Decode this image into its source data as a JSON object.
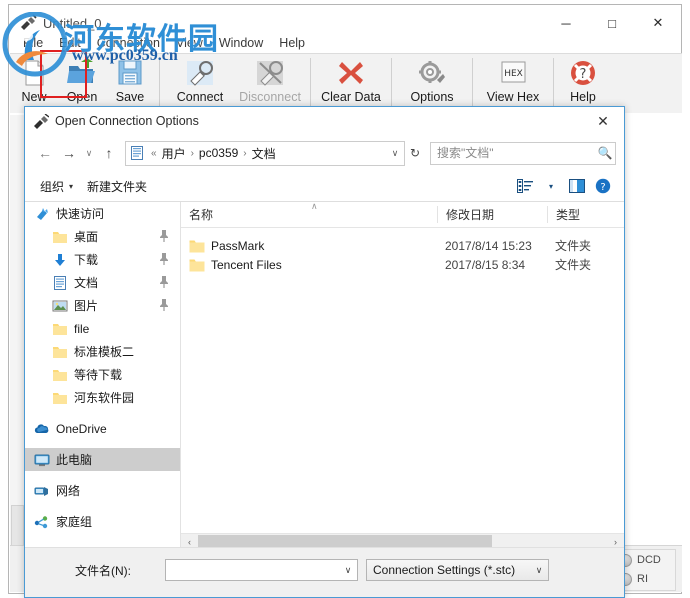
{
  "app": {
    "title": "Untitled_0",
    "window_buttons": {
      "minimize": "─",
      "maximize": "□",
      "close": "✕"
    },
    "menu": [
      "File",
      "Edit",
      "Connection",
      "View",
      "Window",
      "Help"
    ],
    "toolbar": [
      {
        "label": "New",
        "icon": "new-document-icon",
        "disabled": false
      },
      {
        "label": "Open",
        "icon": "open-folder-icon",
        "disabled": false
      },
      {
        "label": "Save",
        "icon": "floppy-disk-icon",
        "disabled": false
      },
      {
        "label": "Connect",
        "icon": "plug-connect-icon",
        "disabled": false
      },
      {
        "label": "Disconnect",
        "icon": "plug-disconnect-icon",
        "disabled": true
      },
      {
        "label": "Clear Data",
        "icon": "red-x-icon",
        "disabled": false
      },
      {
        "label": "Options",
        "icon": "gear-wrench-icon",
        "disabled": false
      },
      {
        "label": "View Hex",
        "icon": "hex-icon",
        "disabled": false
      },
      {
        "label": "Help",
        "icon": "lifebuoy-question-icon",
        "disabled": false
      }
    ],
    "hex_badge": "HEX",
    "status_leds": [
      {
        "label": "DCD"
      },
      {
        "label": "RI"
      }
    ]
  },
  "watermark": {
    "text": "河东软件园",
    "url": "www.pc0359.cn"
  },
  "dialog": {
    "title": "Open Connection Options",
    "icon": "serial-plug-icon",
    "close_label": "✕",
    "nav": {
      "back": "←",
      "forward": "→",
      "recent": "∨",
      "up": "↑"
    },
    "address": {
      "icon": "documents-folder-icon",
      "root_sep": "«",
      "crumbs": [
        "用户",
        "pc0359",
        "文档"
      ],
      "separator": "›",
      "dropdown": "∨",
      "refresh": "↻"
    },
    "search": {
      "placeholder": "搜索\"文档\"",
      "value": "",
      "icon": "magnifier-icon"
    },
    "commandbar": {
      "organize": "组织",
      "organize_caret": "▾",
      "new_folder": "新建文件夹",
      "view_icon": "view-layout-icon",
      "view_caret": "▾",
      "preview_icon": "preview-pane-icon",
      "help_icon": "help-circle-icon"
    },
    "nav_pane": [
      {
        "label": "快速访问",
        "icon": "quick-access-star-icon",
        "indent": false,
        "pinned": false,
        "selected": false
      },
      {
        "label": "桌面",
        "icon": "folder-icon",
        "indent": true,
        "pinned": true,
        "selected": false
      },
      {
        "label": "下载",
        "icon": "downloads-arrow-icon",
        "indent": true,
        "pinned": true,
        "selected": false
      },
      {
        "label": "文档",
        "icon": "documents-icon",
        "indent": true,
        "pinned": true,
        "selected": false
      },
      {
        "label": "图片",
        "icon": "pictures-icon",
        "indent": true,
        "pinned": true,
        "selected": false
      },
      {
        "label": "file",
        "icon": "folder-icon",
        "indent": true,
        "pinned": false,
        "selected": false
      },
      {
        "label": "标准模板二",
        "icon": "folder-icon",
        "indent": true,
        "pinned": false,
        "selected": false
      },
      {
        "label": "等待下载",
        "icon": "folder-icon",
        "indent": true,
        "pinned": false,
        "selected": false
      },
      {
        "label": "河东软件园",
        "icon": "folder-icon",
        "indent": true,
        "pinned": false,
        "selected": false
      },
      {
        "label": "OneDrive",
        "icon": "onedrive-cloud-icon",
        "indent": false,
        "pinned": false,
        "selected": false,
        "gap_before": true
      },
      {
        "label": "此电脑",
        "icon": "this-pc-monitor-icon",
        "indent": false,
        "pinned": false,
        "selected": true,
        "gap_before": true
      },
      {
        "label": "网络",
        "icon": "network-icon",
        "indent": false,
        "pinned": false,
        "selected": false,
        "gap_before": true
      },
      {
        "label": "家庭组",
        "icon": "homegroup-icon",
        "indent": false,
        "pinned": false,
        "selected": false,
        "gap_before": true
      }
    ],
    "file_list": {
      "columns": [
        "名称",
        "修改日期",
        "类型"
      ],
      "sort_indicator": "∧",
      "rows": [
        {
          "name": "PassMark",
          "date": "2017/8/14 15:23",
          "type": "文件夹",
          "icon": "folder-icon"
        },
        {
          "name": "Tencent Files",
          "date": "2017/8/15 8:34",
          "type": "文件夹",
          "icon": "folder-icon"
        }
      ]
    },
    "hscroll": {
      "left": "‹",
      "right": "›"
    },
    "footer": {
      "filename_label": "文件名(N):",
      "filename_value": "",
      "filename_caret": "∨",
      "filter_value": "Connection Settings (*.stc)",
      "filter_caret": "∨"
    }
  },
  "colors": {
    "accent": "#4a9ad4",
    "highlight_red": "#e02020",
    "selection": "#cdcdcd",
    "folder_yellow": "#fcd976",
    "watermark_blue": "#2f8fd6"
  }
}
